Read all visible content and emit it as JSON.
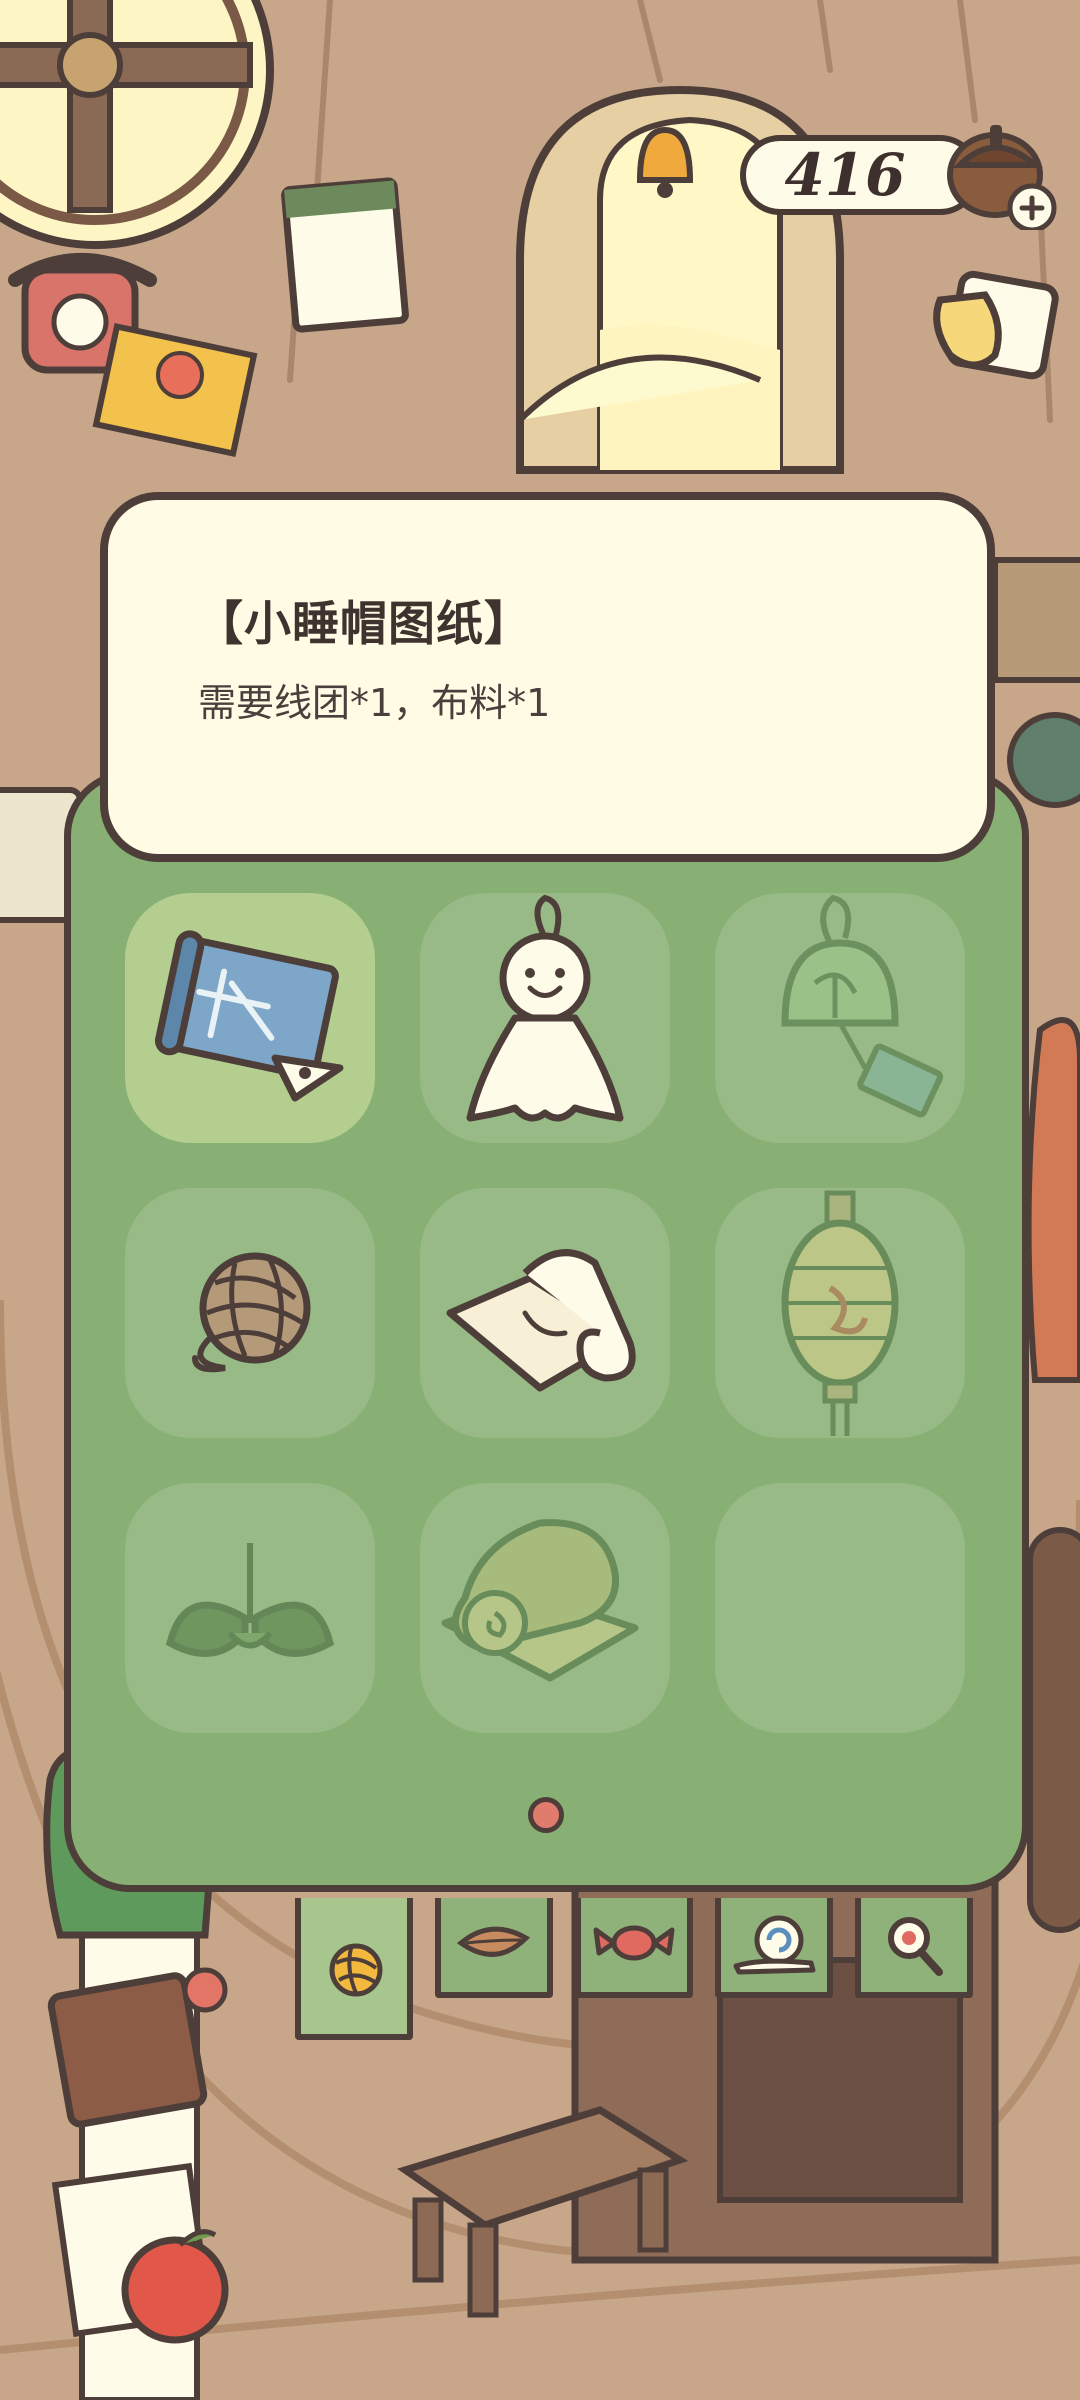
{
  "hud": {
    "clover_count": "416",
    "add_label": "+"
  },
  "popup": {
    "title": "【小睡帽图纸】",
    "description": "需要线团*1，布料*1"
  },
  "grid": {
    "items": [
      {
        "name": "sleeping-cap-blueprint",
        "state": "selected"
      },
      {
        "name": "teru-teru-bozu",
        "state": "available"
      },
      {
        "name": "wind-chime",
        "state": "locked"
      },
      {
        "name": "yarn-ball",
        "state": "available"
      },
      {
        "name": "cloth-roll",
        "state": "available"
      },
      {
        "name": "paper-lantern",
        "state": "locked"
      },
      {
        "name": "leaves",
        "state": "locked"
      },
      {
        "name": "rolled-mat",
        "state": "locked"
      },
      {
        "name": "empty",
        "state": "empty"
      }
    ],
    "page_current": 1,
    "page_total": 1
  },
  "tabs": [
    {
      "icon": "yarn-tab-icon",
      "active": true
    },
    {
      "icon": "leaf-tab-icon",
      "active": false
    },
    {
      "icon": "candy-tab-icon",
      "active": false
    },
    {
      "icon": "snail-tab-icon",
      "active": false
    },
    {
      "icon": "magnifier-tab-icon",
      "active": false
    }
  ],
  "colors": {
    "panel_green": "#88b075",
    "popup_cream": "#fffbe4",
    "outline": "#4d3e3a",
    "page_dot": "#e07b6e"
  }
}
